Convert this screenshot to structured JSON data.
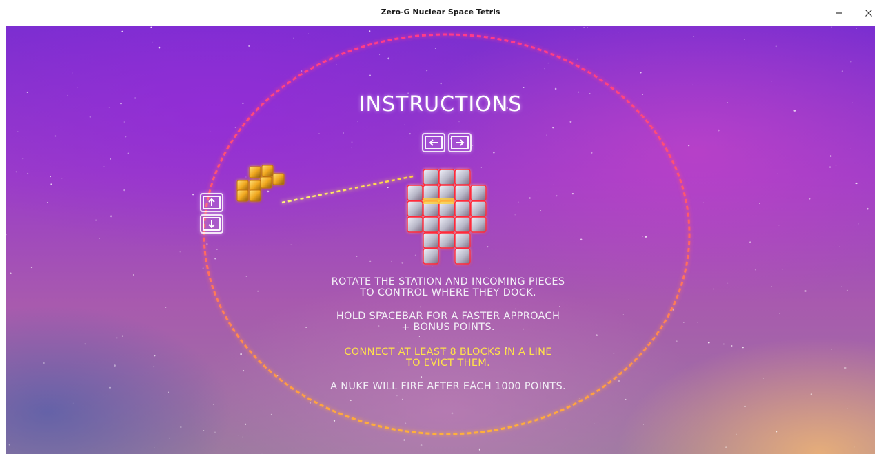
{
  "window": {
    "title": "Zero-G Nuclear Space Tetris",
    "minimize_icon": "minimize-icon",
    "close_icon": "close-icon"
  },
  "screen": {
    "heading": "INSTRUCTIONS",
    "rotate_station_keys": [
      "arrow-left-icon",
      "arrow-right-icon"
    ],
    "rotate_piece_keys": [
      "arrow-up-icon",
      "arrow-down-icon"
    ],
    "lines": [
      {
        "line1": "ROTATE THE STATION AND INCOMING PIECES",
        "line2": "TO CONTROL WHERE THEY DOCK."
      },
      {
        "line1": "HOLD SPACEBAR FOR A FASTER APPROACH",
        "line2": "+ BONUS POINTS."
      },
      {
        "line1": "CONNECT AT LEAST 8 BLOCKS IN A LINE",
        "line2": "TO EVICT THEM."
      },
      {
        "line1": "A NUKE WILL FIRE AFTER EACH 1000 POINTS.",
        "line2": ""
      }
    ]
  },
  "colors": {
    "ring": "#ff3a6e",
    "ring_glow": "#ffb040",
    "highlight_text": "#ffe14a",
    "body_text": "#f2eef6",
    "block_gold": "#f0b020",
    "block_silver": "#c8c8d6"
  }
}
